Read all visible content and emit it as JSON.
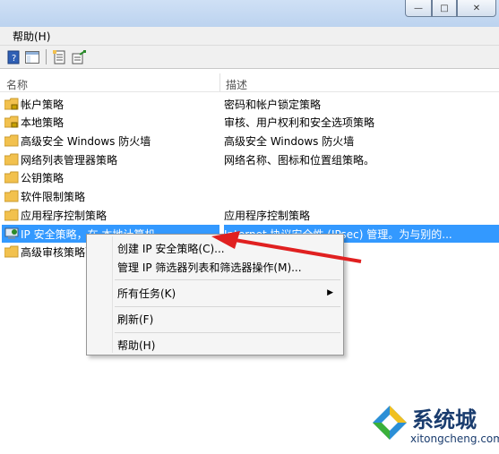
{
  "window": {
    "minimize_glyph": "—",
    "maximize_glyph": "□",
    "close_glyph": "✕"
  },
  "menubar": {
    "help_label": "帮助(H)"
  },
  "toolbar": {
    "icons": [
      "help-book-icon",
      "console-pane-icon",
      "properties-icon",
      "export-list-icon"
    ]
  },
  "list": {
    "columns": {
      "name": "名称",
      "description": "描述"
    },
    "rows": [
      {
        "name": "帐户策略",
        "description": "密码和帐户锁定策略",
        "icon": "folder-lock-icon"
      },
      {
        "name": "本地策略",
        "description": "审核、用户权利和安全选项策略",
        "icon": "folder-lock-icon"
      },
      {
        "name": "高级安全 Windows 防火墙",
        "description": "高级安全 Windows 防火墙",
        "icon": "folder-icon"
      },
      {
        "name": "网络列表管理器策略",
        "description": "网络名称、图标和位置组策略。",
        "icon": "folder-icon"
      },
      {
        "name": "公钥策略",
        "description": "",
        "icon": "folder-icon"
      },
      {
        "name": "软件限制策略",
        "description": "",
        "icon": "folder-icon"
      },
      {
        "name": "应用程序控制策略",
        "description": "应用程序控制策略",
        "icon": "folder-icon"
      },
      {
        "name": "IP 安全策略，在 本地计算机",
        "description": "Internet 协议安全性 (IPsec) 管理。为与别的...",
        "icon": "ipsec-policy-icon"
      },
      {
        "name": "高级审核策略配置",
        "description": "",
        "icon": "folder-icon"
      }
    ]
  },
  "context_menu": {
    "items": [
      {
        "label": "创建 IP 安全策略(C)..."
      },
      {
        "label": "管理 IP 筛选器列表和筛选器操作(M)..."
      },
      {
        "label": "所有任务(K)",
        "has_submenu": true
      },
      {
        "label": "刷新(F)"
      },
      {
        "label": "帮助(H)"
      }
    ]
  },
  "annotation": {
    "color": "#e02020"
  },
  "watermark": {
    "title": "系统城",
    "url": "xitongcheng.com"
  },
  "colors": {
    "selection": "#3399ff",
    "folder": "#f2c14e"
  }
}
